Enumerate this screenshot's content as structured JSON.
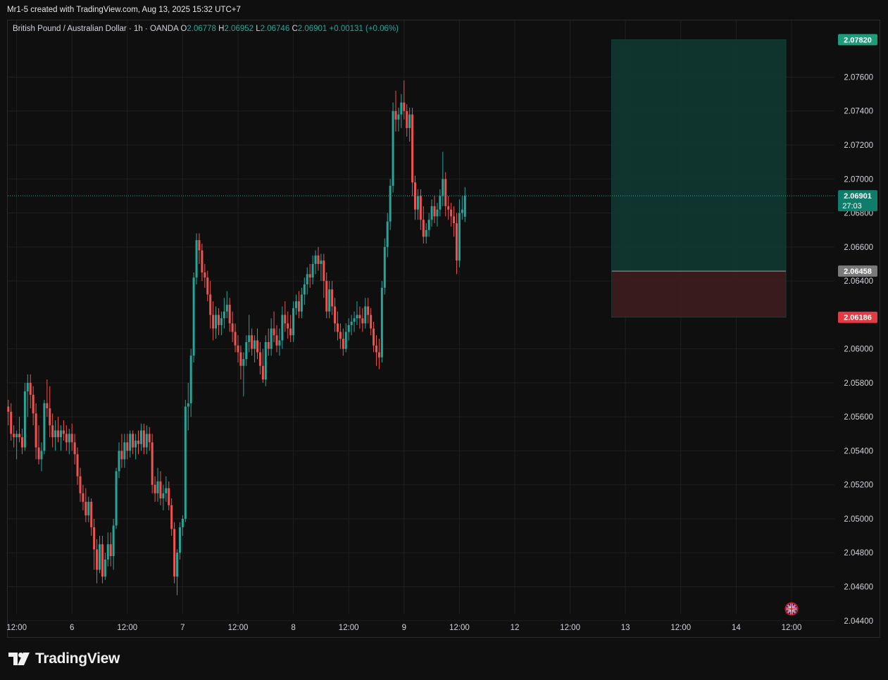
{
  "header": {
    "credit": "Mr1-5 created with TradingView.com, Aug 13, 2025 15:32 UTC+7"
  },
  "legend": {
    "symbol": "British Pound / Australian Dollar · 1h · OANDA",
    "o_label": "O",
    "o_value": "2.06778",
    "h_label": "H",
    "h_value": "2.06952",
    "l_label": "L",
    "l_value": "2.06746",
    "c_label": "C",
    "c_value": "2.06901",
    "change": "+0.00131 (+0.06%)"
  },
  "colors": {
    "up": "#26a69a",
    "down": "#ef5350",
    "background": "#0f0f0f",
    "grid": "#1f1f1f",
    "profit_zone": "#0f3a32",
    "loss_zone": "#3d1c1f"
  },
  "branding": {
    "logo_text": "TradingView",
    "logo_icon": "tradingview-logo-icon",
    "flag_icon": "uk-flag-icon"
  },
  "chart_data": {
    "type": "candlestick",
    "symbol": "GBPAUD",
    "timeframe": "1h",
    "ylim": [
      2.043,
      2.0788
    ],
    "y_ticks": [
      "2.07600",
      "2.07400",
      "2.07200",
      "2.07000",
      "2.06800",
      "2.06600",
      "2.06400",
      "2.06000",
      "2.05800",
      "2.05600",
      "2.05400",
      "2.05200",
      "2.05000",
      "2.04800",
      "2.04600",
      "2.04400"
    ],
    "x_ticks": [
      "12:00",
      "6",
      "12:00",
      "7",
      "12:00",
      "8",
      "12:00",
      "9",
      "12:00",
      "12",
      "12:00",
      "13",
      "12:00",
      "14",
      "12:00"
    ],
    "x_tick_bars": [
      3,
      23,
      43,
      63,
      83,
      103,
      123,
      143,
      163,
      183,
      203,
      223,
      243,
      263,
      283
    ],
    "position": {
      "type": "long",
      "target": 2.0782,
      "target_label": "2.07820",
      "entry": 2.06458,
      "entry_label": "2.06458",
      "stop": 2.06186,
      "stop_label": "2.06186",
      "start_bar": 218,
      "end_bar": 281
    },
    "last_price": 2.06901,
    "last_price_label": "2.06901",
    "countdown": "27:03",
    "candles": [
      [
        2.0566,
        2.057,
        2.0555,
        2.0563
      ],
      [
        2.0563,
        2.0568,
        2.0546,
        2.055
      ],
      [
        2.055,
        2.0555,
        2.0542,
        2.0548
      ],
      [
        2.0548,
        2.0552,
        2.0535,
        2.055
      ],
      [
        2.055,
        2.056,
        2.0545,
        2.0548
      ],
      [
        2.0548,
        2.0553,
        2.0538,
        2.0542
      ],
      [
        2.0542,
        2.058,
        2.054,
        2.0575
      ],
      [
        2.0575,
        2.0585,
        2.056,
        2.058
      ],
      [
        2.058,
        2.0585,
        2.0565,
        2.0573
      ],
      [
        2.0573,
        2.0578,
        2.0555,
        2.0562
      ],
      [
        2.0562,
        2.0568,
        2.0535,
        2.0542
      ],
      [
        2.0542,
        2.0555,
        2.0532,
        2.0535
      ],
      [
        2.0535,
        2.0545,
        2.0528,
        2.054
      ],
      [
        2.054,
        2.057,
        2.0538,
        2.0568
      ],
      [
        2.0568,
        2.0582,
        2.056,
        2.0565
      ],
      [
        2.0565,
        2.0578,
        2.0548,
        2.0555
      ],
      [
        2.0555,
        2.0562,
        2.0542,
        2.0548
      ],
      [
        2.0548,
        2.0558,
        2.054,
        2.0552
      ],
      [
        2.0552,
        2.056,
        2.0545,
        2.0548
      ],
      [
        2.0548,
        2.0555,
        2.054,
        2.0552
      ],
      [
        2.0552,
        2.0558,
        2.0546,
        2.055
      ],
      [
        2.055,
        2.0555,
        2.054,
        2.0545
      ],
      [
        2.0545,
        2.0553,
        2.0538,
        2.055
      ],
      [
        2.055,
        2.0556,
        2.054,
        2.0545
      ],
      [
        2.0545,
        2.055,
        2.0532,
        2.0538
      ],
      [
        2.0538,
        2.0542,
        2.052,
        2.0525
      ],
      [
        2.0525,
        2.053,
        2.051,
        2.0515
      ],
      [
        2.0515,
        2.052,
        2.0505,
        2.051
      ],
      [
        2.051,
        2.0518,
        2.0498,
        2.0502
      ],
      [
        2.0502,
        2.0513,
        2.0498,
        2.051
      ],
      [
        2.051,
        2.0512,
        2.049,
        2.0495
      ],
      [
        2.0495,
        2.05,
        2.047,
        2.0482
      ],
      [
        2.0482,
        2.0488,
        2.0462,
        2.047
      ],
      [
        2.047,
        2.049,
        2.0468,
        2.0485
      ],
      [
        2.0485,
        2.049,
        2.0462,
        2.0466
      ],
      [
        2.0466,
        2.048,
        2.0464,
        2.0476
      ],
      [
        2.0476,
        2.0492,
        2.0472,
        2.0485
      ],
      [
        2.0485,
        2.0492,
        2.0472,
        2.0478
      ],
      [
        2.0478,
        2.05,
        2.047,
        2.0496
      ],
      [
        2.0496,
        2.053,
        2.0494,
        2.0528
      ],
      [
        2.0528,
        2.0545,
        2.0524,
        2.054
      ],
      [
        2.054,
        2.055,
        2.053,
        2.0535
      ],
      [
        2.0535,
        2.055,
        2.053,
        2.0545
      ],
      [
        2.0545,
        2.055,
        2.0535,
        2.054
      ],
      [
        2.054,
        2.0552,
        2.0536,
        2.055
      ],
      [
        2.055,
        2.0552,
        2.0538,
        2.0542
      ],
      [
        2.0542,
        2.055,
        2.0535,
        2.0546
      ],
      [
        2.0546,
        2.0552,
        2.0538,
        2.0544
      ],
      [
        2.0544,
        2.0556,
        2.054,
        2.0552
      ],
      [
        2.0552,
        2.0556,
        2.0538,
        2.0542
      ],
      [
        2.0542,
        2.0555,
        2.0538,
        2.055
      ],
      [
        2.055,
        2.0554,
        2.054,
        2.0545
      ],
      [
        2.0545,
        2.055,
        2.0515,
        2.052
      ],
      [
        2.052,
        2.0525,
        2.051,
        2.0515
      ],
      [
        2.0515,
        2.053,
        2.051,
        2.0522
      ],
      [
        2.0522,
        2.0528,
        2.0508,
        2.0512
      ],
      [
        2.0512,
        2.052,
        2.0505,
        2.0515
      ],
      [
        2.0515,
        2.0525,
        2.051,
        2.0518
      ],
      [
        2.0518,
        2.0522,
        2.0505,
        2.0508
      ],
      [
        2.0508,
        2.0512,
        2.049,
        2.0494
      ],
      [
        2.0494,
        2.0498,
        2.0462,
        2.0466
      ],
      [
        2.0466,
        2.0482,
        2.0455,
        2.048
      ],
      [
        2.048,
        2.0498,
        2.0476,
        2.0495
      ],
      [
        2.0495,
        2.0502,
        2.049,
        2.05
      ],
      [
        2.05,
        2.057,
        2.0498,
        2.0566
      ],
      [
        2.0566,
        2.058,
        2.0552,
        2.0568
      ],
      [
        2.0568,
        2.06,
        2.056,
        2.0596
      ],
      [
        2.0596,
        2.0645,
        2.0592,
        2.0642
      ],
      [
        2.0642,
        2.0668,
        2.0638,
        2.0664
      ],
      [
        2.0664,
        2.0668,
        2.065,
        2.0658
      ],
      [
        2.0658,
        2.0662,
        2.064,
        2.0645
      ],
      [
        2.0645,
        2.065,
        2.0636,
        2.0642
      ],
      [
        2.0642,
        2.0646,
        2.0628,
        2.0632
      ],
      [
        2.0632,
        2.064,
        2.0612,
        2.062
      ],
      [
        2.062,
        2.0628,
        2.0605,
        2.0612
      ],
      [
        2.0612,
        2.0625,
        2.0606,
        2.062
      ],
      [
        2.062,
        2.0624,
        2.0608,
        2.0614
      ],
      [
        2.0614,
        2.0622,
        2.0608,
        2.0618
      ],
      [
        2.0618,
        2.063,
        2.0612,
        2.0622
      ],
      [
        2.0622,
        2.0634,
        2.0618,
        2.0626
      ],
      [
        2.0626,
        2.063,
        2.061,
        2.0615
      ],
      [
        2.0615,
        2.0622,
        2.0604,
        2.061
      ],
      [
        2.061,
        2.0615,
        2.0598,
        2.0602
      ],
      [
        2.0602,
        2.0608,
        2.0592,
        2.0598
      ],
      [
        2.0598,
        2.0602,
        2.0582,
        2.059
      ],
      [
        2.059,
        2.0598,
        2.0572,
        2.0594
      ],
      [
        2.0594,
        2.0608,
        2.059,
        2.0604
      ],
      [
        2.0604,
        2.062,
        2.0598,
        2.0608
      ],
      [
        2.0608,
        2.0612,
        2.0596,
        2.06
      ],
      [
        2.06,
        2.0608,
        2.0592,
        2.0605
      ],
      [
        2.0605,
        2.0612,
        2.0594,
        2.0598
      ],
      [
        2.0598,
        2.0604,
        2.0585,
        2.059
      ],
      [
        2.059,
        2.06,
        2.058,
        2.0582
      ],
      [
        2.0582,
        2.0608,
        2.0578,
        2.0604
      ],
      [
        2.0604,
        2.0612,
        2.0596,
        2.06
      ],
      [
        2.06,
        2.0618,
        2.0596,
        2.0612
      ],
      [
        2.0612,
        2.0622,
        2.0604,
        2.0608
      ],
      [
        2.0608,
        2.0614,
        2.0598,
        2.0602
      ],
      [
        2.0602,
        2.0612,
        2.0596,
        2.0605
      ],
      [
        2.0605,
        2.0625,
        2.06,
        2.062
      ],
      [
        2.062,
        2.0628,
        2.061,
        2.0615
      ],
      [
        2.0615,
        2.0622,
        2.0606,
        2.0612
      ],
      [
        2.0612,
        2.062,
        2.0604,
        2.0608
      ],
      [
        2.0608,
        2.0628,
        2.0604,
        2.0624
      ],
      [
        2.0624,
        2.0632,
        2.062,
        2.0628
      ],
      [
        2.0628,
        2.0634,
        2.0618,
        2.0622
      ],
      [
        2.0622,
        2.0636,
        2.0618,
        2.0632
      ],
      [
        2.0632,
        2.0642,
        2.0626,
        2.0638
      ],
      [
        2.0638,
        2.0648,
        2.0632,
        2.0644
      ],
      [
        2.0644,
        2.065,
        2.0636,
        2.0642
      ],
      [
        2.0642,
        2.0655,
        2.0638,
        2.065
      ],
      [
        2.065,
        2.0658,
        2.0644,
        2.0655
      ],
      [
        2.0655,
        2.066,
        2.0646,
        2.065
      ],
      [
        2.065,
        2.0656,
        2.064,
        2.0652
      ],
      [
        2.0652,
        2.0656,
        2.063,
        2.064
      ],
      [
        2.064,
        2.0645,
        2.0618,
        2.0622
      ],
      [
        2.0622,
        2.064,
        2.0618,
        2.0635
      ],
      [
        2.0635,
        2.064,
        2.062,
        2.0625
      ],
      [
        2.0625,
        2.063,
        2.061,
        2.0615
      ],
      [
        2.0615,
        2.0622,
        2.0605,
        2.061
      ],
      [
        2.061,
        2.0615,
        2.06,
        2.0606
      ],
      [
        2.0606,
        2.0612,
        2.0596,
        2.06
      ],
      [
        2.06,
        2.0615,
        2.0598,
        2.061
      ],
      [
        2.061,
        2.0618,
        2.0605,
        2.0614
      ],
      [
        2.0614,
        2.062,
        2.0608,
        2.0616
      ],
      [
        2.0616,
        2.0622,
        2.061,
        2.0618
      ],
      [
        2.0618,
        2.0628,
        2.0614,
        2.062
      ],
      [
        2.062,
        2.0625,
        2.0612,
        2.0618
      ],
      [
        2.0618,
        2.0624,
        2.061,
        2.0615
      ],
      [
        2.0615,
        2.063,
        2.0612,
        2.0625
      ],
      [
        2.0625,
        2.063,
        2.0615,
        2.062
      ],
      [
        2.062,
        2.0624,
        2.0608,
        2.0612
      ],
      [
        2.0612,
        2.0616,
        2.0598,
        2.0602
      ],
      [
        2.0602,
        2.0608,
        2.059,
        2.0598
      ],
      [
        2.0598,
        2.0606,
        2.0588,
        2.0595
      ],
      [
        2.0595,
        2.064,
        2.0592,
        2.0636
      ],
      [
        2.0636,
        2.0665,
        2.0632,
        2.066
      ],
      [
        2.066,
        2.068,
        2.0654,
        2.0675
      ],
      [
        2.0675,
        2.07,
        2.067,
        2.0696
      ],
      [
        2.0696,
        2.0745,
        2.0692,
        2.074
      ],
      [
        2.074,
        2.0752,
        2.0728,
        2.0735
      ],
      [
        2.0735,
        2.0742,
        2.0728,
        2.0738
      ],
      [
        2.0738,
        2.075,
        2.073,
        2.0745
      ],
      [
        2.0745,
        2.0758,
        2.0735,
        2.074
      ],
      [
        2.074,
        2.0744,
        2.0725,
        2.073
      ],
      [
        2.073,
        2.0742,
        2.0722,
        2.0738
      ],
      [
        2.0738,
        2.0742,
        2.069,
        2.0698
      ],
      [
        2.0698,
        2.0702,
        2.0676,
        2.0682
      ],
      [
        2.0682,
        2.0694,
        2.0676,
        2.069
      ],
      [
        2.069,
        2.0694,
        2.067,
        2.0676
      ],
      [
        2.0676,
        2.0684,
        2.0662,
        2.0666
      ],
      [
        2.0666,
        2.0674,
        2.0662,
        2.067
      ],
      [
        2.067,
        2.068,
        2.0666,
        2.0676
      ],
      [
        2.0676,
        2.0688,
        2.0672,
        2.0684
      ],
      [
        2.0684,
        2.069,
        2.0674,
        2.0678
      ],
      [
        2.0678,
        2.0686,
        2.0672,
        2.0682
      ],
      [
        2.0682,
        2.0694,
        2.0678,
        2.069
      ],
      [
        2.069,
        2.0716,
        2.0684,
        2.07
      ],
      [
        2.07,
        2.0704,
        2.0678,
        2.0684
      ],
      [
        2.0684,
        2.069,
        2.0676,
        2.0682
      ],
      [
        2.0682,
        2.0686,
        2.0672,
        2.0678
      ],
      [
        2.0678,
        2.0684,
        2.0666,
        2.0674
      ],
      [
        2.0674,
        2.068,
        2.0644,
        2.0652
      ],
      [
        2.0652,
        2.0688,
        2.0648,
        2.068
      ],
      [
        2.068,
        2.069,
        2.0676,
        2.0682
      ],
      [
        2.06778,
        2.06952,
        2.06746,
        2.06901
      ]
    ]
  }
}
